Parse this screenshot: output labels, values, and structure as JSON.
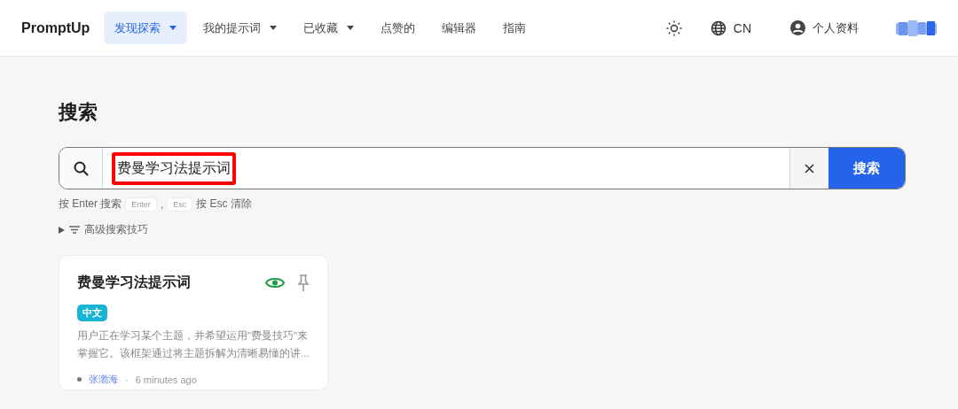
{
  "header": {
    "logo": "PromptUp",
    "nav": [
      {
        "label": "发现探索",
        "selected": true,
        "dropdown": true
      },
      {
        "label": "我的提示词",
        "selected": false,
        "dropdown": true
      },
      {
        "label": "已收藏",
        "selected": false,
        "dropdown": true
      },
      {
        "label": "点赞的",
        "selected": false,
        "dropdown": false
      },
      {
        "label": "编辑器",
        "selected": false,
        "dropdown": false
      },
      {
        "label": "指南",
        "selected": false,
        "dropdown": false
      }
    ],
    "language": "CN",
    "profile": "个人资料"
  },
  "page_title": "搜索",
  "search": {
    "value": "费曼学习法提示词",
    "button": "搜索",
    "hint_parts": [
      "按 Enter 搜索",
      "Enter",
      ",",
      "Esc",
      "按 Esc 清除"
    ],
    "advanced": "高级搜索技巧",
    "expanded": false
  },
  "cards": [
    {
      "title": "费曼学习法提示词",
      "tag": "中文",
      "description": "用户正在学习某个主题，并希望运用\"费曼技巧\"来掌握它。该框架通过将主题拆解为清晰易懂的讲...",
      "author": "张渤海",
      "separator": "·",
      "time": "6 minutes ago",
      "viewed": true
    }
  ]
}
